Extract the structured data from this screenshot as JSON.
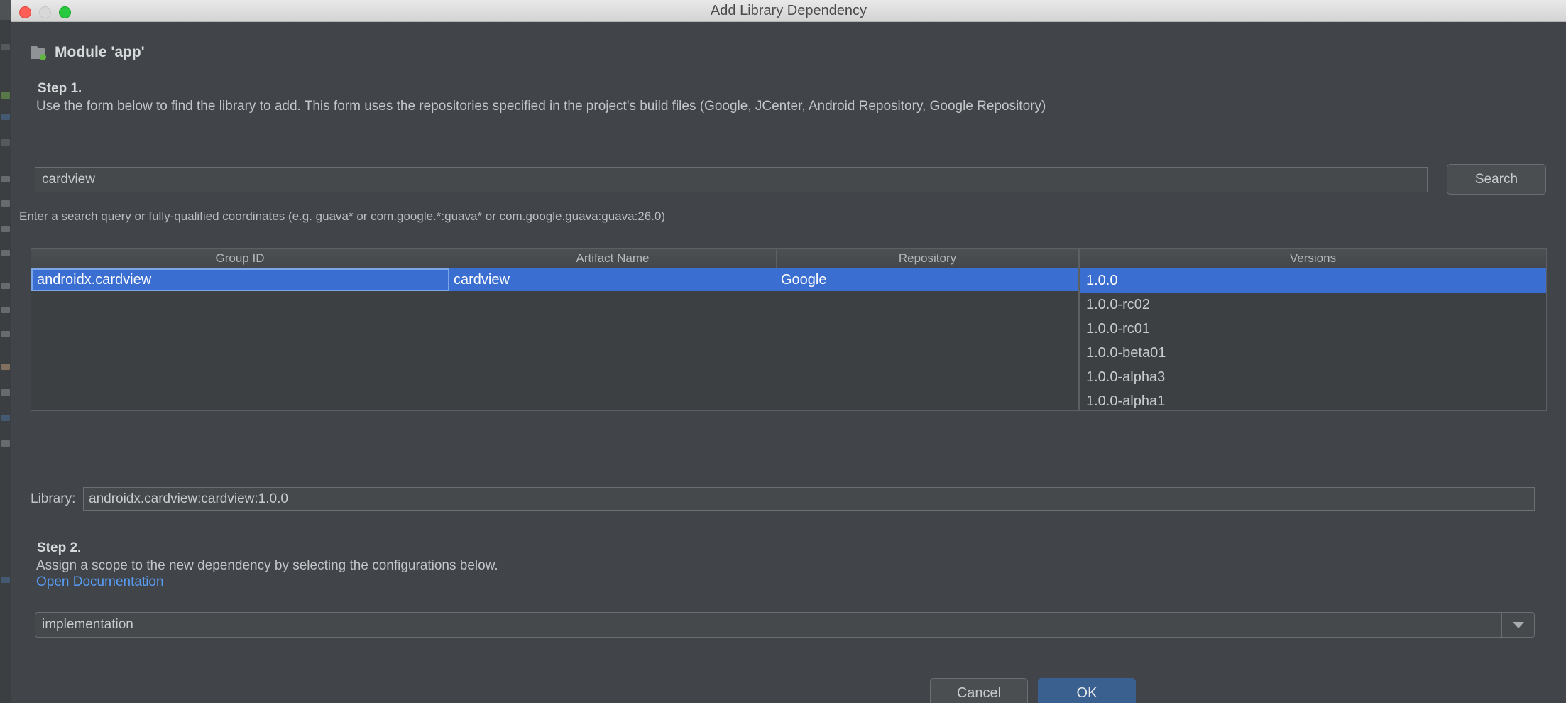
{
  "window": {
    "title": "Add Library Dependency",
    "traffic_lights": [
      "close-button",
      "minimize-button",
      "zoom-button"
    ]
  },
  "module": {
    "icon": "module-folder-icon",
    "label": "Module 'app'"
  },
  "step1": {
    "title": "Step 1.",
    "description": "Use the form below to find the library to add. This form uses the repositories specified in the project's build files (Google, JCenter, Android Repository, Google Repository)"
  },
  "search": {
    "value": "cardview",
    "placeholder": "",
    "button_label": "Search",
    "hint": "Enter a search query or fully-qualified coordinates (e.g. guava* or com.google.*:guava* or com.google.guava:guava:26.0)"
  },
  "results_table": {
    "columns": [
      "Group ID",
      "Artifact Name",
      "Repository"
    ],
    "rows": [
      {
        "group_id": "androidx.cardview",
        "artifact_name": "cardview",
        "repository": "Google",
        "selected": true
      }
    ]
  },
  "versions_panel": {
    "column": "Versions",
    "items": [
      {
        "label": "1.0.0",
        "selected": true
      },
      {
        "label": "1.0.0-rc02",
        "selected": false
      },
      {
        "label": "1.0.0-rc01",
        "selected": false
      },
      {
        "label": "1.0.0-beta01",
        "selected": false
      },
      {
        "label": "1.0.0-alpha3",
        "selected": false
      },
      {
        "label": "1.0.0-alpha1",
        "selected": false
      }
    ]
  },
  "library": {
    "label": "Library:",
    "value": "androidx.cardview:cardview:1.0.0",
    "placeholder": ""
  },
  "step2": {
    "title": "Step 2.",
    "description": "Assign a scope to the new dependency by selecting the configurations below.",
    "doc_link": "Open Documentation"
  },
  "configuration": {
    "selected": "implementation"
  },
  "footer": {
    "cancel_label": "Cancel",
    "ok_label": "OK"
  },
  "colors": {
    "selection_blue": "#3a6ed0",
    "focus_border": "#7ba7e8",
    "link_blue": "#589df6",
    "ok_blue": "#3a6090",
    "dialog_bg": "#414549",
    "module_dot_green": "#62b543"
  }
}
